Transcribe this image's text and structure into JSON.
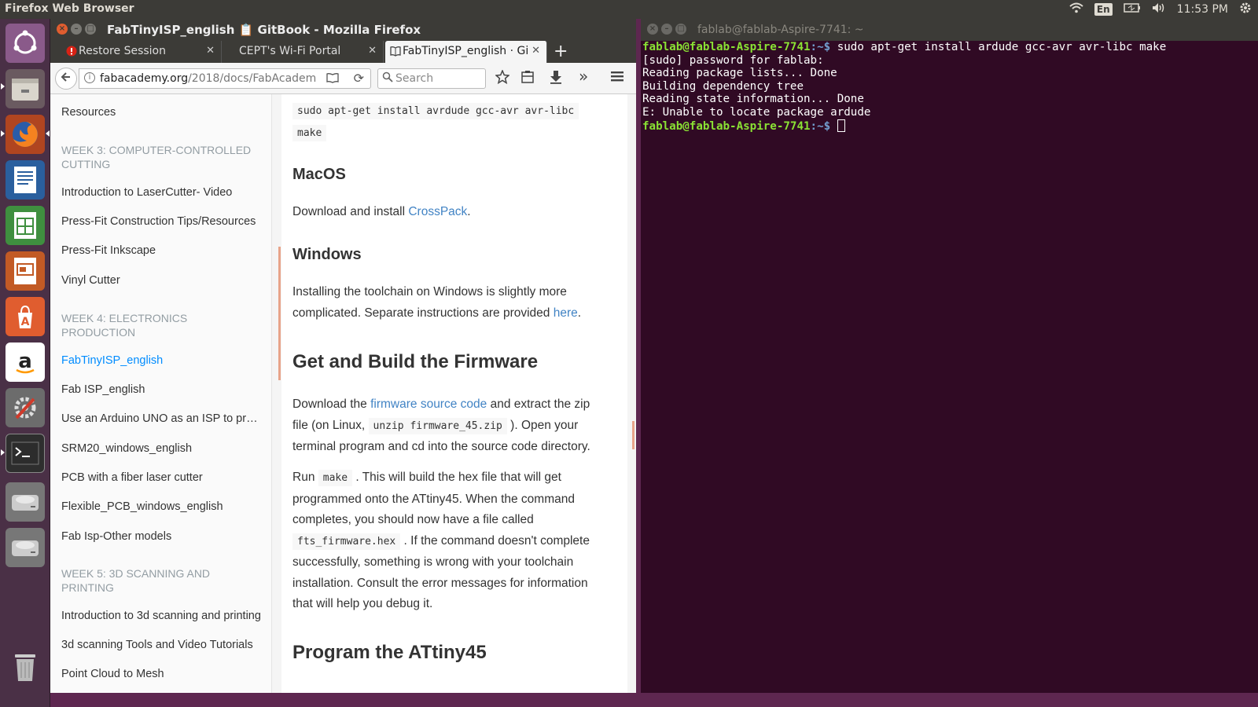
{
  "topbar": {
    "app_title": "Firefox Web Browser",
    "keyboard": "En",
    "clock": "11:53 PM",
    "icons": [
      "wifi-icon",
      "keyboard-icon",
      "battery-icon",
      "volume-icon",
      "settings-gear-icon"
    ]
  },
  "launcher": {
    "items": [
      "ubuntu-dash",
      "files",
      "firefox",
      "libreoffice-writer",
      "libreoffice-calc",
      "libreoffice-impress",
      "ubuntu-software",
      "amazon",
      "system-settings",
      "terminal",
      "disk-drive-1",
      "disk-drive-2",
      "trash"
    ]
  },
  "firefox": {
    "window_title": "FabTinyISP_english 📋 GitBook - Mozilla Firefox",
    "tabs": [
      {
        "label": "Restore Session"
      },
      {
        "label": "CEPT's Wi-Fi Portal"
      },
      {
        "label": "FabTinyISP_english · Gi"
      }
    ],
    "url_domain": "fabacademy.org",
    "url_path": "/2018/docs/FabAcadem",
    "search_placeholder": "Search"
  },
  "sidebar": {
    "items": [
      {
        "type": "item",
        "label": "Resources"
      },
      {
        "type": "header",
        "label": "WEEK 3: COMPUTER-CONTROLLED CUTTING"
      },
      {
        "type": "item",
        "label": "Introduction to LaserCutter- Video"
      },
      {
        "type": "item",
        "label": "Press-Fit Construction Tips/Resources"
      },
      {
        "type": "item",
        "label": "Press-Fit Inkscape"
      },
      {
        "type": "item",
        "label": "Vinyl Cutter"
      },
      {
        "type": "header",
        "label": "WEEK 4: ELECTRONICS PRODUCTION"
      },
      {
        "type": "item",
        "label": "FabTinyISP_english",
        "active": true
      },
      {
        "type": "item",
        "label": "Fab ISP_english"
      },
      {
        "type": "item",
        "label": "Use an Arduino UNO as an ISP to program"
      },
      {
        "type": "item",
        "label": "SRM20_windows_english"
      },
      {
        "type": "item",
        "label": "PCB with a fiber laser cutter"
      },
      {
        "type": "item",
        "label": "Flexible_PCB_windows_english"
      },
      {
        "type": "item",
        "label": "Fab Isp-Other models"
      },
      {
        "type": "header",
        "label": "WEEK 5: 3D SCANNING AND PRINTING"
      },
      {
        "type": "item",
        "label": "Introduction to 3d scanning and printing"
      },
      {
        "type": "item",
        "label": "3d scanning Tools and Video Tutorials"
      },
      {
        "type": "item",
        "label": "Point Cloud to Mesh"
      }
    ]
  },
  "content": {
    "code_line1": "sudo apt-get install avrdude gcc-avr avr-libc",
    "code_line2": "make",
    "macos_heading": "MacOS",
    "macos_text": "Download and install ",
    "macos_link": "CrossPack",
    "windows_heading": "Windows",
    "windows_text": "Installing the toolchain on Windows is slightly more complicated. Separate instructions are provided ",
    "windows_link": "here",
    "build_heading": "Get and Build the Firmware",
    "build_text1": "Download the ",
    "build_link": "firmware source code",
    "build_text2": " and extract the zip file (on Linux, ",
    "build_code": "unzip firmware_45.zip",
    "build_text3": " ). Open your terminal program and cd into the source code directory.",
    "run_text1": "Run ",
    "run_code": "make",
    "run_text2": " . This will build the hex file that will get programmed onto the ATtiny45. When the command completes, you should now have a file called ",
    "run_code2": "fts_firmware.hex",
    "run_text3": " . If the command doesn't complete successfully, something is wrong with your toolchain installation. Consult the error messages for information that will help you debug it.",
    "program_heading": "Program the ATtiny45"
  },
  "terminal": {
    "title": "fablab@fablab-Aspire-7741: ~",
    "prompt_user": "fablab@fablab-Aspire-7741",
    "prompt_path": ":~$",
    "command": " sudo apt-get install ardude gcc-avr avr-libc make",
    "output": [
      "[sudo] password for fablab:",
      "Reading package lists... Done",
      "Building dependency tree",
      "Reading state information... Done",
      "E: Unable to locate package ardude"
    ]
  }
}
